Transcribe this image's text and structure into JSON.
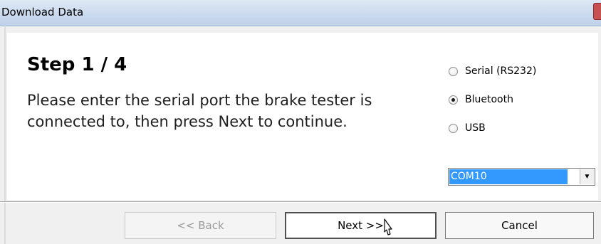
{
  "window": {
    "title": "Download Data"
  },
  "step": {
    "title": "Step 1 / 4",
    "instructions": "Please enter the serial port the brake tester is connected to, then press Next to continue."
  },
  "connection_options": [
    {
      "label": "Serial (RS232)",
      "checked": false
    },
    {
      "label": "Bluetooth",
      "checked": true
    },
    {
      "label": "USB",
      "checked": false
    }
  ],
  "port_select": {
    "value": "COM10"
  },
  "buttons": {
    "back": "<< Back",
    "next": "Next >>",
    "cancel": "Cancel"
  },
  "colors": {
    "selection": "#3399ff"
  }
}
